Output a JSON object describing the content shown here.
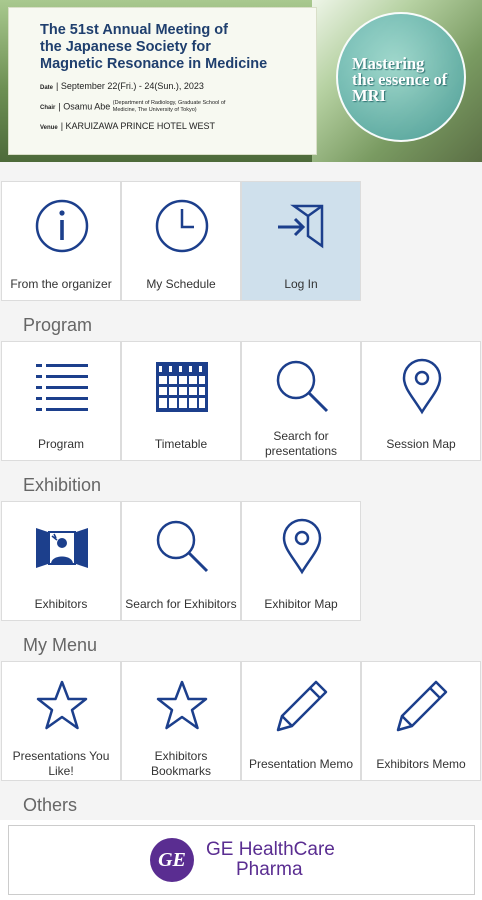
{
  "banner": {
    "title_lines": [
      "The 51st Annual Meeting of",
      "the Japanese Society for",
      "Magnetic Resonance in Medicine"
    ],
    "date_key": "Date",
    "date_value": "September 22(Fri.) - 24(Sun.), 2023",
    "chair_key": "Chair",
    "chair_value": "Osamu Abe",
    "chair_note": "(Department of Radiology, Graduate School of Medicine, The University of Tokyo)",
    "venue_key": "Venue",
    "venue_value": "KARUIZAWA PRINCE HOTEL WEST",
    "tagline_lines": [
      "Mastering",
      "the essence of",
      "MRI"
    ]
  },
  "top_tiles": [
    {
      "label": "From the organizer",
      "icon": "info-icon"
    },
    {
      "label": "My Schedule",
      "icon": "clock-icon"
    },
    {
      "label": "Log In",
      "icon": "login-icon"
    }
  ],
  "sections": {
    "program": {
      "title": "Program",
      "tiles": [
        {
          "label": "Program",
          "icon": "list-icon"
        },
        {
          "label": "Timetable",
          "icon": "calendar-icon"
        },
        {
          "label": "Search for presentations",
          "icon": "search-icon"
        },
        {
          "label": "Session Map",
          "icon": "map-pin-icon"
        }
      ]
    },
    "exhibition": {
      "title": "Exhibition",
      "tiles": [
        {
          "label": "Exhibitors",
          "icon": "exhibitor-booth-icon"
        },
        {
          "label": "Search for Exhibitors",
          "icon": "search-icon"
        },
        {
          "label": "Exhibitor Map",
          "icon": "map-pin-icon"
        }
      ]
    },
    "my_menu": {
      "title": "My Menu",
      "tiles": [
        {
          "label": "Presentations You Like!",
          "icon": "star-icon"
        },
        {
          "label": "Exhibitors Bookmarks",
          "icon": "star-icon"
        },
        {
          "label": "Presentation Memo",
          "icon": "pencil-icon"
        },
        {
          "label": "Exhibitors Memo",
          "icon": "pencil-icon"
        }
      ]
    },
    "others": {
      "title": "Others"
    }
  },
  "ad": {
    "logo_text": "GE",
    "brand_line1": "GE HealthCare",
    "brand_line2": "Pharma"
  },
  "colors": {
    "icon_blue": "#1c3f8c",
    "active_tile": "#cfe0ec",
    "ad_purple": "#5a2d91"
  }
}
